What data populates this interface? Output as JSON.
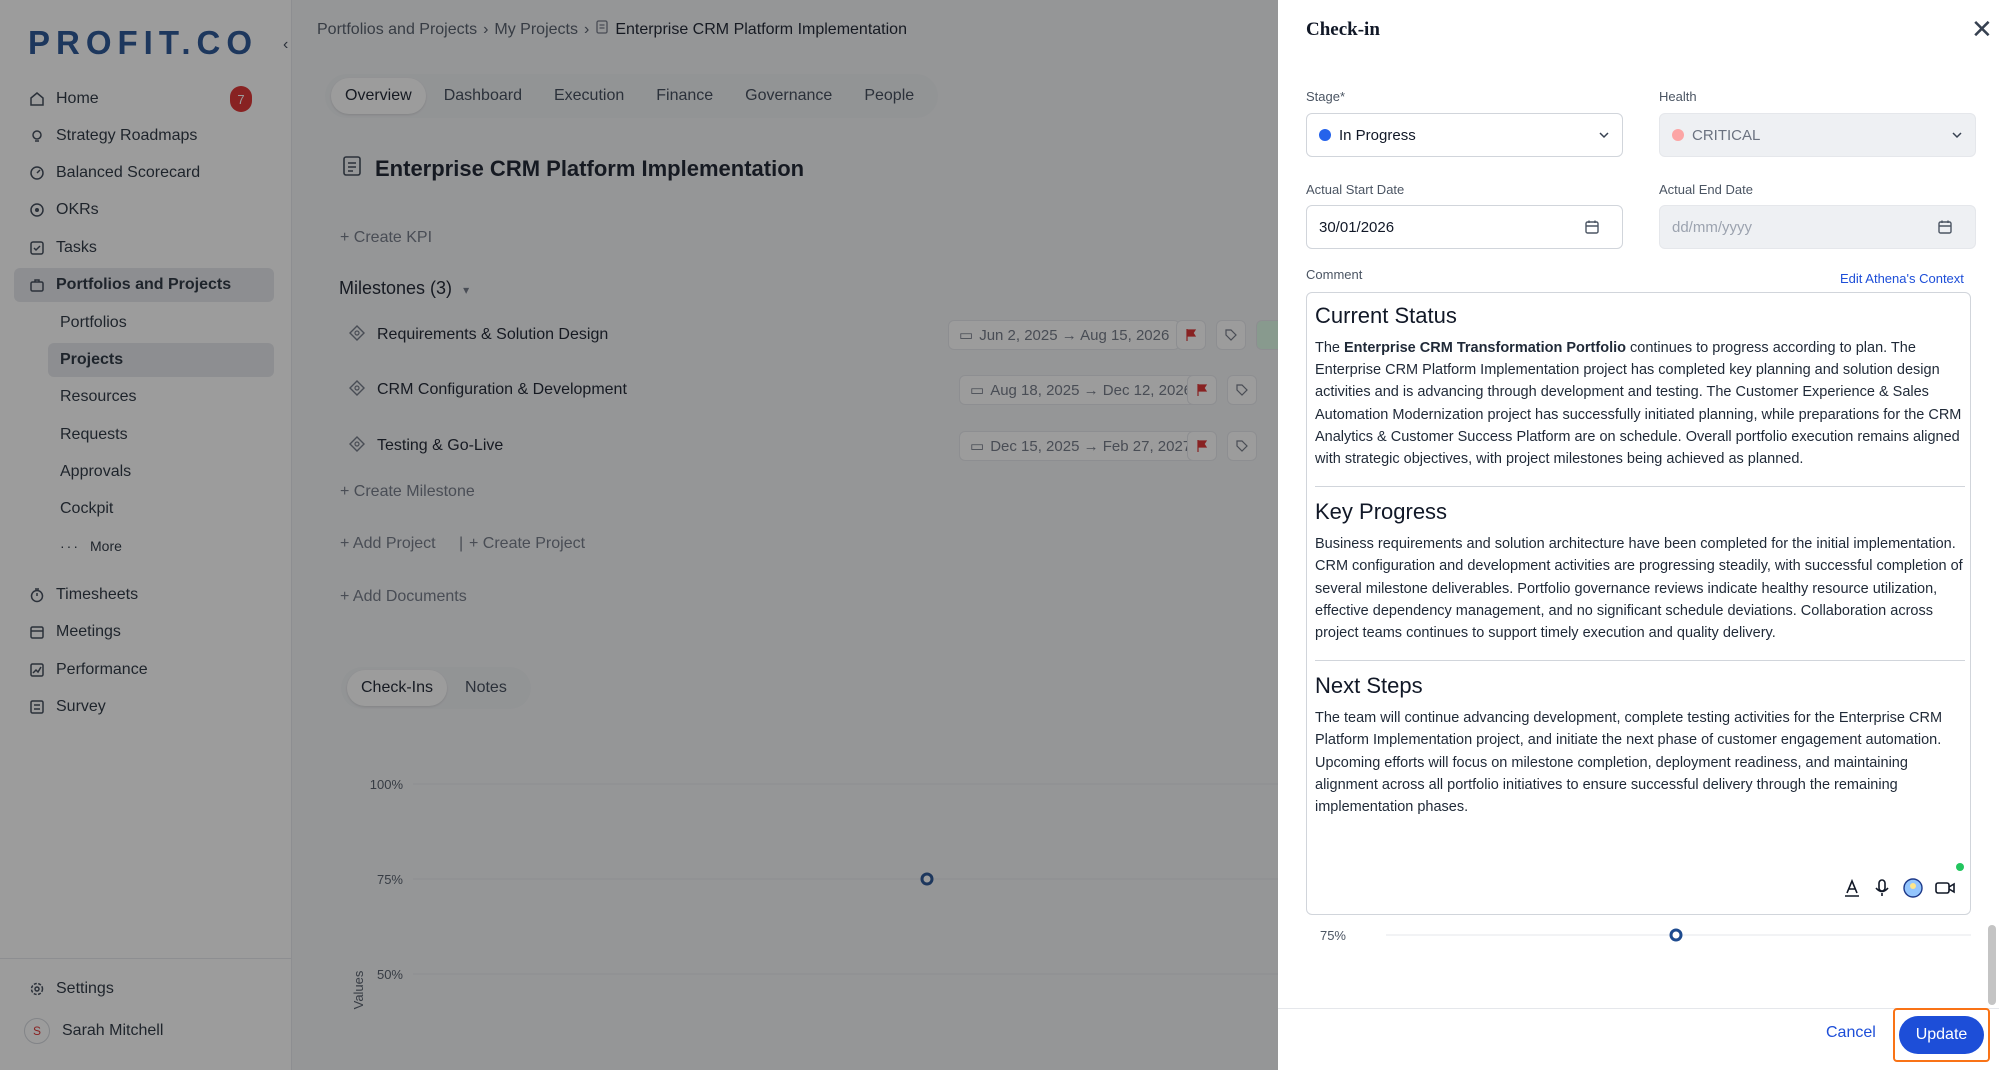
{
  "brand": {
    "logo": "PROFIT.CO"
  },
  "sidebar": {
    "items": [
      {
        "label": "Home",
        "badge": "7"
      },
      {
        "label": "Strategy Roadmaps"
      },
      {
        "label": "Balanced Scorecard"
      },
      {
        "label": "OKRs"
      },
      {
        "label": "Tasks"
      },
      {
        "label": "Portfolios and Projects"
      }
    ],
    "sub_items": [
      "Portfolios",
      "Projects",
      "Resources",
      "Requests",
      "Approvals",
      "Cockpit",
      "More"
    ],
    "lower_items": [
      "Timesheets",
      "Meetings",
      "Performance",
      "Survey"
    ],
    "settings": "Settings",
    "user": {
      "initial": "S",
      "name": "Sarah Mitchell"
    }
  },
  "breadcrumb": [
    "Portfolios and Projects",
    "My Projects",
    "Enterprise CRM Platform Implementation"
  ],
  "tabs": [
    "Overview",
    "Dashboard",
    "Execution",
    "Finance",
    "Governance",
    "People"
  ],
  "page": {
    "title": "Enterprise CRM Platform Implementation",
    "create_kpi": "+ Create KPI",
    "milestones_heading": "Milestones (3)",
    "milestones": [
      {
        "name": "Requirements & Solution Design",
        "dates": "Jun 2, 2025 → Aug 15, 2026"
      },
      {
        "name": "CRM Configuration & Development",
        "dates": "Aug 18, 2025 → Dec 12, 2026"
      },
      {
        "name": "Testing & Go-Live",
        "dates": "Dec 15, 2025 → Feb 27, 2027"
      }
    ],
    "create_milestone": "+ Create Milestone",
    "add_project": "+ Add Project",
    "create_project": "+ Create Project",
    "add_documents": "+ Add Documents",
    "subtabs": [
      "Check-Ins",
      "Notes"
    ],
    "chart_ticks": [
      "100%",
      "75%",
      "50%"
    ],
    "chart_ylabel": "Values"
  },
  "chart_data": {
    "type": "line",
    "ylabel": "Values",
    "yticks": [
      "100%",
      "75%",
      "50%"
    ],
    "series": [
      {
        "values": [
          75
        ]
      }
    ]
  },
  "checkin": {
    "title": "Check-in",
    "stage_label": "Stage*",
    "stage_value": "In Progress",
    "health_label": "Health",
    "health_value": "CRITICAL",
    "start_label": "Actual Start Date",
    "start_value": "30/01/2026",
    "end_label": "Actual End Date",
    "end_placeholder": "dd/mm/yyyy",
    "comment_label": "Comment",
    "athena_link": "Edit Athena's Context",
    "sections": [
      {
        "heading": "Current Status",
        "pre": "The ",
        "bold": "Enterprise CRM Transformation Portfolio",
        "post": " continues to progress according to plan. The Enterprise CRM Platform Implementation project has completed key planning and solution design activities and is advancing through development and testing. The Customer Experience & Sales Automation Modernization project has successfully initiated planning, while preparations for the CRM Analytics & Customer Success Platform are on schedule. Overall portfolio execution remains aligned with strategic objectives, with project milestones being achieved as planned."
      },
      {
        "heading": "Key Progress",
        "text": "Business requirements and solution architecture have been completed for the initial implementation. CRM configuration and development activities are progressing steadily, with successful completion of several milestone deliverables. Portfolio governance reviews indicate healthy resource utilization, effective dependency management, and no significant schedule deviations. Collaboration across project teams continues to support timely execution and quality delivery."
      },
      {
        "heading": "Next Steps",
        "text": "The team will continue advancing development, complete testing activities for the Enterprise CRM Platform Implementation project, and initiate the next phase of customer engagement automation. Upcoming efforts will focus on milestone completion, deployment readiness, and maintaining alignment across all portfolio initiatives to ensure successful delivery through the remaining implementation phases."
      }
    ],
    "chart_tick": "75%",
    "cancel": "Cancel",
    "update": "Update"
  },
  "colors": {
    "accent": "#1d4ed8",
    "critical": "#fca5a5",
    "in_progress": "#2563eb",
    "flag": "#dc2626",
    "highlight": "#f97316"
  }
}
